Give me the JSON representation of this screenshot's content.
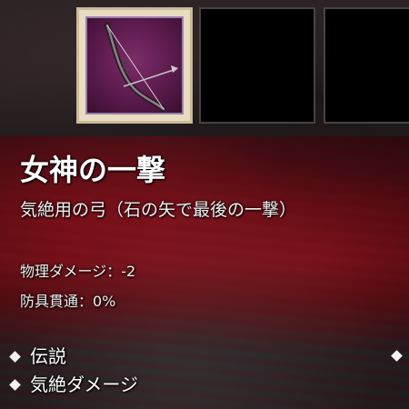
{
  "slots": [
    {
      "state": "selected",
      "icon": "bow-icon",
      "frame_color": "#e9dcc0",
      "bg_color": "#5b1a4c"
    },
    {
      "state": "empty"
    },
    {
      "state": "empty"
    }
  ],
  "item": {
    "name": "女神の一撃",
    "subtitle": "気絶用の弓（石の矢で最後の一撃）",
    "stats": [
      {
        "label": "物理ダメージ：-2"
      },
      {
        "label": "防具貫通：0%"
      }
    ],
    "traits": [
      {
        "label": "伝説"
      },
      {
        "label": "気絶ダメージ"
      }
    ]
  },
  "colors": {
    "panel_red": "#7d121c",
    "text": "#ffffff"
  }
}
